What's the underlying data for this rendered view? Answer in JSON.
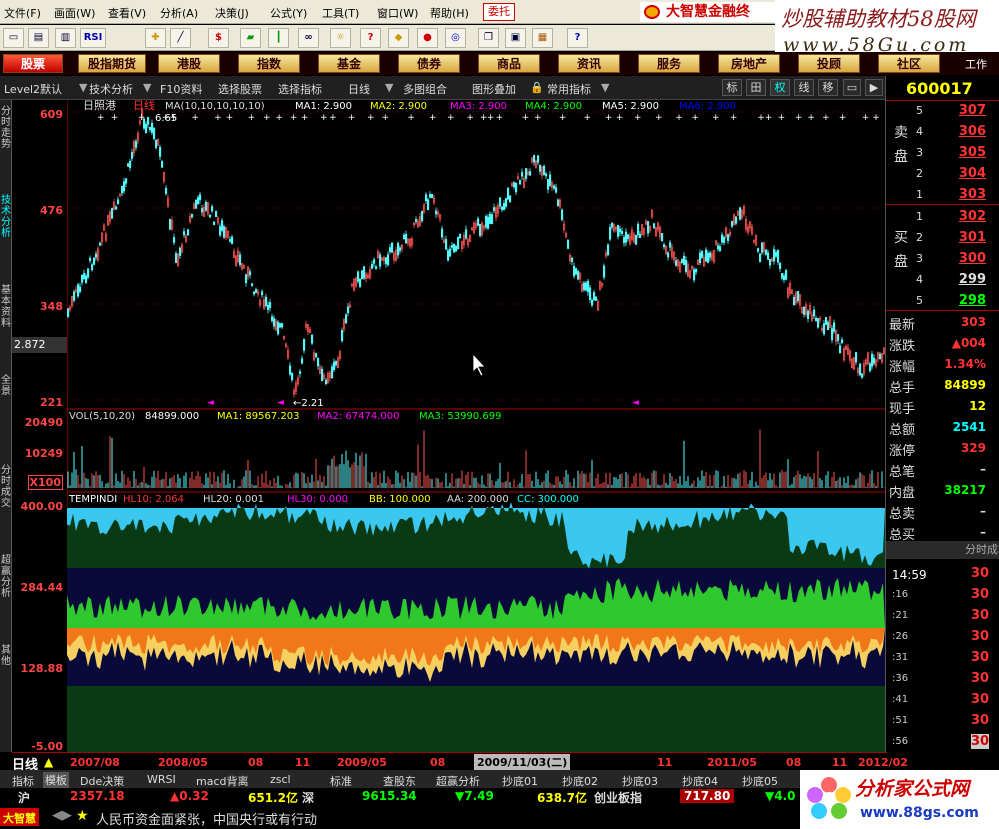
{
  "menu": {
    "items": [
      "文件(F)",
      "画面(W)",
      "查看(V)",
      "分析(A)",
      "决策(J)",
      "公式(Y)",
      "工具(T)",
      "窗口(W)",
      "帮助(H)"
    ],
    "weituo": "委托",
    "brand": "大智慧金融终"
  },
  "watermark": {
    "line1": "炒股辅助教材58股网",
    "line2": "www.58Gu.com"
  },
  "toolbar": {
    "icons": [
      "open-icon",
      "screen-icon",
      "chart-icon",
      "rsi-button",
      "crosshair-icon",
      "ruler-icon",
      "dollar-icon",
      "flag-icon",
      "bars-icon",
      "binoculars-icon",
      "lightbulb-icon",
      "info-icon",
      "diamond-icon",
      "candy-icon",
      "globe-icon",
      "copy-icon",
      "window-icon",
      "books-icon",
      "help-icon"
    ],
    "rsi": "RSI"
  },
  "nav": {
    "items": [
      "股票",
      "股指期货",
      "港股",
      "指数",
      "基金",
      "债券",
      "商品",
      "资讯",
      "服务",
      "房地产",
      "投顾",
      "社区"
    ],
    "extra": "工作"
  },
  "tabs": {
    "level2": "Level2默认",
    "tech": "技术分析",
    "f10": "F10资料",
    "select_stock": "选择股票",
    "select_ind": "选择指标",
    "period": "日线",
    "multi": "多图组合",
    "overlay": "图形叠加",
    "common": "常用指标",
    "btns": [
      "标",
      "田",
      "权",
      "线",
      "移"
    ]
  },
  "left_tabs": [
    "分时走势",
    "技术分析",
    "基本资料",
    "全景",
    "分时成交",
    "超赢分析",
    "其他"
  ],
  "axis": {
    "price": [
      "609",
      "476",
      "348",
      "221"
    ],
    "current": "2.872",
    "vol": [
      "20490",
      "10249",
      "X100"
    ],
    "ind": [
      "400.00",
      "284.44",
      "128.88",
      "-5.00"
    ]
  },
  "chart": {
    "title": "日照港",
    "period": "日线",
    "ma_line": "MA(10,10,10,10,10)",
    "ma1": "MA1: 2.900",
    "ma2": "MA2: 2.900",
    "ma3": "MA3: 2.900",
    "ma4": "MA4: 2.900",
    "ma5": "MA5: 2.900",
    "ma6": "MA6: 2.900",
    "high_mark": "6.65",
    "low_mark": "←2.21",
    "vol_line": "VOL(5,10,20)",
    "vol_val": "84899.000",
    "vma1": "MA1: 89567.203",
    "vma2": "MA2: 67474.000",
    "vma3": "MA3: 53990.699",
    "ind_name": "TEMPINDI",
    "hl10": "HL10: 2.064",
    "hl20": "HL20: 0.001",
    "hl30": "HL30: 0.000",
    "bb": "BB: 100.000",
    "aa": "AA: 200.000",
    "cc": "CC: 300.000"
  },
  "quote": {
    "code": "600017",
    "asks": [
      {
        "n": "5",
        "p": "307"
      },
      {
        "n": "4",
        "p": "306"
      },
      {
        "n": "3",
        "p": "305"
      },
      {
        "n": "2",
        "p": "304"
      },
      {
        "n": "1",
        "p": "303"
      }
    ],
    "bids": [
      {
        "n": "1",
        "p": "302"
      },
      {
        "n": "2",
        "p": "301"
      },
      {
        "n": "3",
        "p": "300"
      },
      {
        "n": "4",
        "p": "299"
      },
      {
        "n": "5",
        "p": "298"
      }
    ],
    "sell_label": "卖盘",
    "buy_label": "买盘",
    "stats": [
      {
        "k": "最新",
        "v": "303",
        "c": "#f33"
      },
      {
        "k": "涨跌",
        "v": "▲004",
        "c": "#f33"
      },
      {
        "k": "涨幅",
        "v": "1.34%",
        "c": "#f33"
      },
      {
        "k": "总手",
        "v": "84899",
        "c": "#ff0"
      },
      {
        "k": "现手",
        "v": "12",
        "c": "#ff0"
      },
      {
        "k": "总额",
        "v": "2541",
        "c": "#0ff"
      },
      {
        "k": "涨停",
        "v": "329",
        "c": "#f33"
      },
      {
        "k": "总笔",
        "v": "–",
        "c": "#ddd"
      },
      {
        "k": "内盘",
        "v": "38217",
        "c": "#0f0"
      },
      {
        "k": "总卖",
        "v": "–",
        "c": "#ddd"
      },
      {
        "k": "总买",
        "v": "–",
        "c": "#ddd"
      }
    ],
    "ticks_header": "分时成",
    "ticks": [
      {
        "t": "14:59",
        "v": "30"
      },
      {
        "t": ":16",
        "v": "30"
      },
      {
        "t": ":21",
        "v": "30"
      },
      {
        "t": ":26",
        "v": "30"
      },
      {
        "t": ":31",
        "v": "30"
      },
      {
        "t": ":36",
        "v": "30"
      },
      {
        "t": ":41",
        "v": "30"
      },
      {
        "t": ":51",
        "v": "30"
      },
      {
        "t": ":56",
        "v": "30"
      }
    ]
  },
  "dates": {
    "period": "日线",
    "labels": [
      "2007/08",
      "2008/05",
      "08",
      "11",
      "2009/05",
      "08",
      "2009/11/03(二)",
      "11",
      "2011/05",
      "08",
      "11",
      "2012/02"
    ]
  },
  "bottom_tabs": [
    "指标",
    "模板",
    "Dde决策",
    "WRSI",
    "macd背离",
    "zscl",
    "标准",
    "查股东",
    "超赢分析",
    "抄底01",
    "抄底02",
    "抄底03",
    "抄底04",
    "抄底05"
  ],
  "ticker": {
    "sh": "沪",
    "sh_val": "2357.18",
    "sh_chg": "▲0.32",
    "sh_amt": "651.2亿",
    "sz": "深",
    "sz_val": "9615.34",
    "sz_chg": "▼7.49",
    "sz_amt": "638.7亿",
    "cyb": "创业板指",
    "cyb_val": "717.80",
    "cyb_chg": "▼4.0"
  },
  "news": {
    "logo": "大智慧",
    "star": "★",
    "text": "人民币资金面紧张，中国央行或有行动"
  },
  "logo2": {
    "line1": "分析家公式网",
    "line2": "www.88gs.com"
  }
}
